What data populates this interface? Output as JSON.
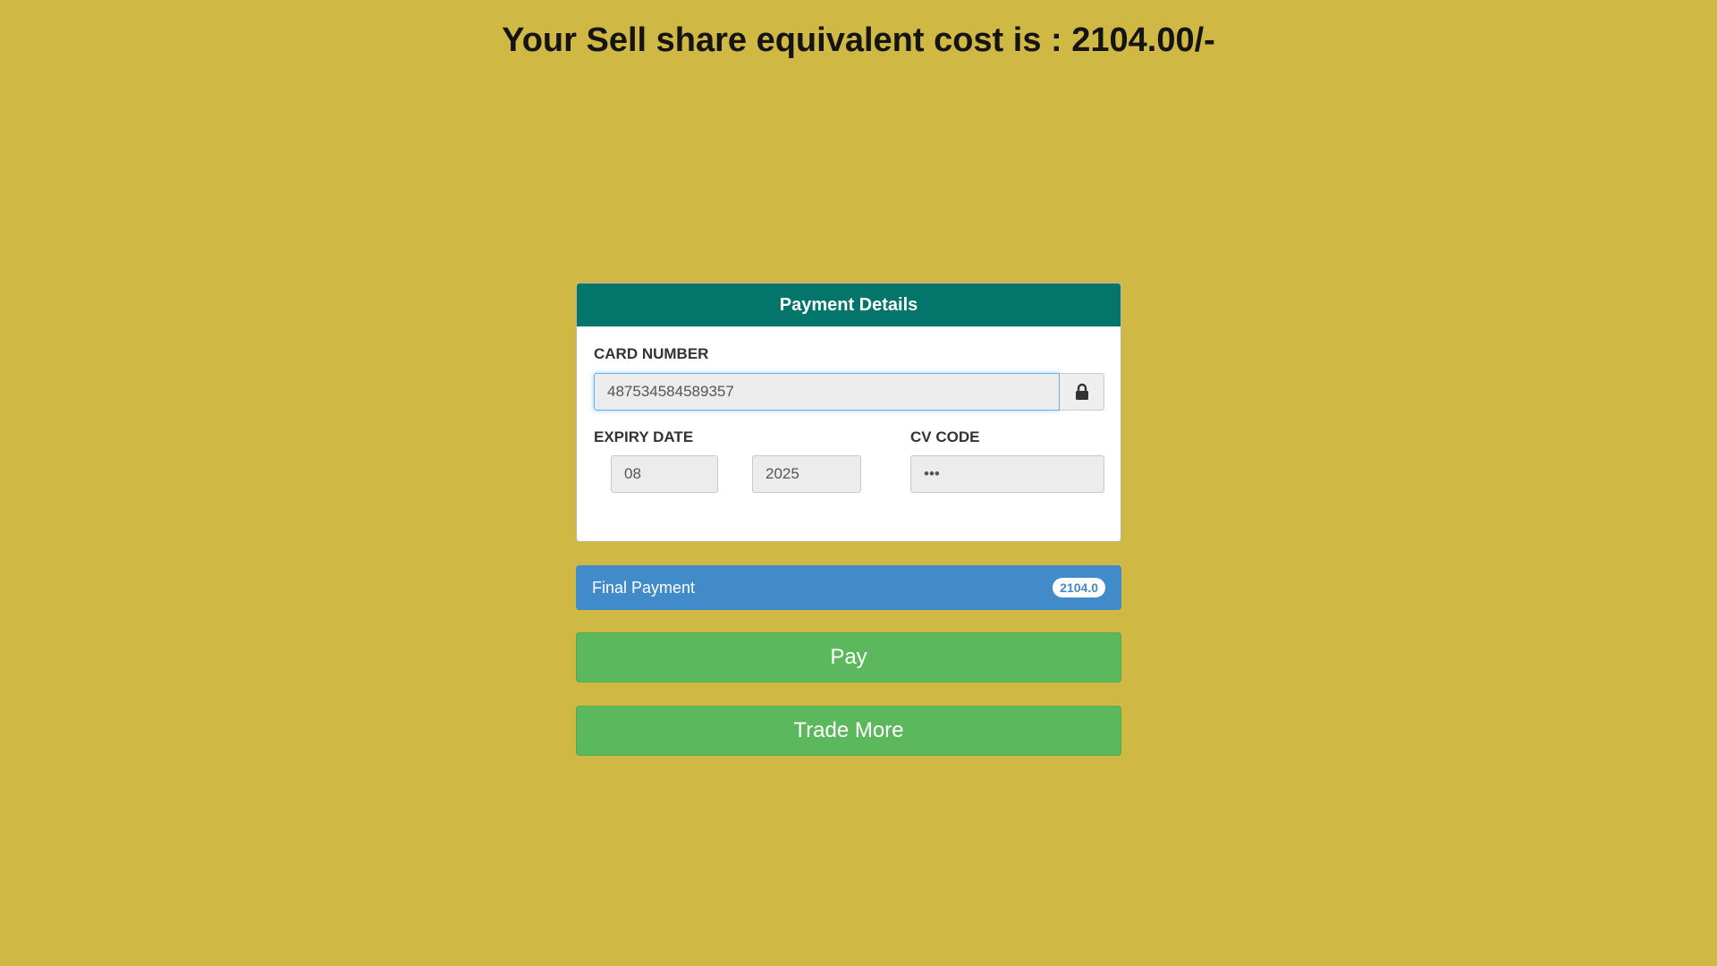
{
  "headline": "Your Sell share equivalent cost is : 2104.00/-",
  "payment_panel": {
    "title": "Payment Details",
    "card_number_label": "CARD NUMBER",
    "card_number_value": "487534584589357",
    "lock_icon": "lock-icon",
    "expiry_label": "EXPIRY DATE",
    "expiry_month": "08",
    "expiry_year": "2025",
    "cv_label": "CV CODE",
    "cv_value": "•••"
  },
  "final_payment": {
    "label": "Final Payment",
    "amount": "2104.0"
  },
  "buttons": {
    "pay": "Pay",
    "trade_more": "Trade More"
  },
  "colors": {
    "background": "#cfb844",
    "panel_heading": "#04756b",
    "final_bar": "#428bca",
    "button": "#5cb85c"
  }
}
